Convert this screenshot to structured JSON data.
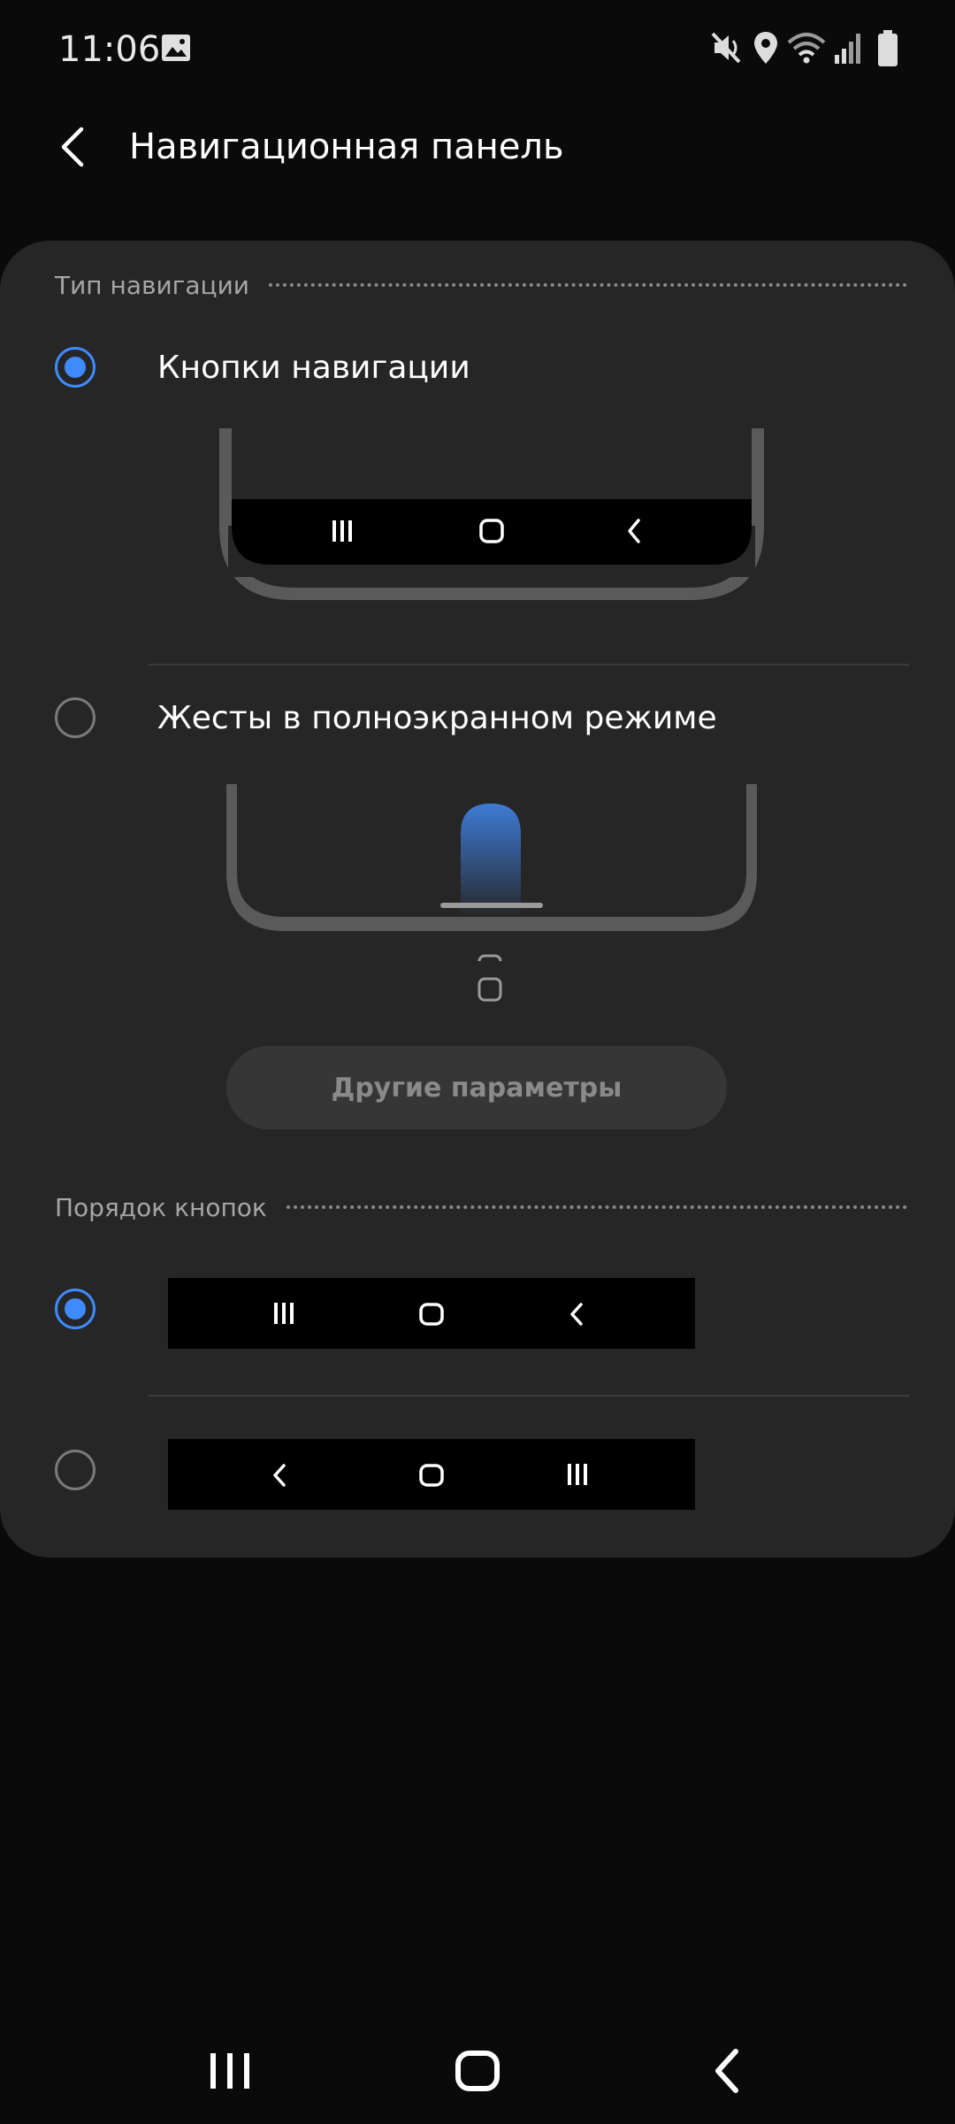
{
  "status_bar": {
    "time": "11:06",
    "icons": [
      "image-icon",
      "mute-icon",
      "location-icon",
      "wifi-icon",
      "signal-icon",
      "battery-icon"
    ]
  },
  "app_bar": {
    "title": "Навигационная панель",
    "back_icon": "back-arrow-icon"
  },
  "navigation_type": {
    "header": "Тип навигации",
    "options": [
      {
        "label": "Кнопки навигации",
        "selected": true
      },
      {
        "label": "Жесты в полноэкранном режиме",
        "selected": false
      }
    ],
    "more_button": "Другие параметры"
  },
  "button_order": {
    "header": "Порядок кнопок",
    "options": [
      {
        "order": [
          "recents-icon",
          "home-icon",
          "back-icon"
        ],
        "selected": true
      },
      {
        "order": [
          "back-icon",
          "home-icon",
          "recents-icon"
        ],
        "selected": false
      }
    ]
  },
  "system_nav": [
    "recents-icon",
    "home-icon",
    "back-icon"
  ],
  "colors": {
    "background": "#0a0a0a",
    "card": "#262626",
    "accent": "#3e8bff",
    "nav_preview": "#000000"
  }
}
